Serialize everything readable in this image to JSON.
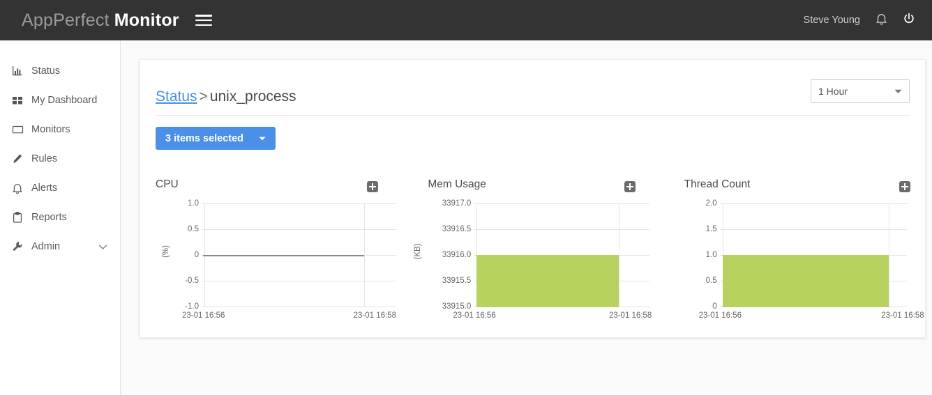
{
  "header": {
    "brand_primary": "AppPerfect",
    "brand_secondary": "Monitor",
    "menu_icon": "hamburger-icon",
    "username": "Steve Young",
    "bell_icon": "bell-icon",
    "power_icon": "power-icon"
  },
  "sidebar": {
    "items": [
      {
        "label": "Status",
        "icon": "bar-chart-icon",
        "has_caret": false
      },
      {
        "label": "My Dashboard",
        "icon": "grid-icon",
        "has_caret": false
      },
      {
        "label": "Monitors",
        "icon": "monitor-icon",
        "has_caret": false
      },
      {
        "label": "Rules",
        "icon": "pencil-icon",
        "has_caret": false
      },
      {
        "label": "Alerts",
        "icon": "bell-icon",
        "has_caret": false
      },
      {
        "label": "Reports",
        "icon": "clipboard-icon",
        "has_caret": false
      },
      {
        "label": "Admin",
        "icon": "wrench-icon",
        "has_caret": true
      }
    ]
  },
  "main": {
    "breadcrumb": {
      "link": "Status",
      "separator": ">",
      "current": "unix_process"
    },
    "time_range": {
      "selected": "1 Hour",
      "caret_icon": "chevron-down-icon"
    },
    "multiselect": {
      "label": "3 items selected",
      "caret_icon": "caret-down-icon",
      "accent_color": "#4a90e8"
    }
  },
  "colors": {
    "series_green": "#b7d25e",
    "link_blue": "#4a90e2",
    "header_dark": "#333333"
  },
  "chart_data": [
    {
      "type": "area",
      "title": "CPU",
      "expand_icon": "plus-icon",
      "ylabel": "(%)",
      "xlabel": "",
      "yticks": [
        "1.0",
        "0.5",
        "0",
        "-0.5",
        "-1.0"
      ],
      "ylim": [
        -1.0,
        1.0
      ],
      "xticks": [
        "23-01 16:56",
        "23-01 16:58"
      ],
      "x": [
        "23-01 16:56",
        "23-01 16:58"
      ],
      "values": [
        0,
        0
      ],
      "grid": true,
      "legend": false
    },
    {
      "type": "area",
      "title": "Mem Usage",
      "expand_icon": "plus-icon",
      "ylabel": "(KB)",
      "xlabel": "",
      "yticks": [
        "33917.0",
        "33916.5",
        "33916.0",
        "33915.5",
        "33915.0"
      ],
      "ylim": [
        33915.0,
        33917.0
      ],
      "xticks": [
        "23-01 16:56",
        "23-01 16:58"
      ],
      "x": [
        "23-01 16:56",
        "23-01 16:58"
      ],
      "values": [
        33916.0,
        33916.0
      ],
      "grid": true,
      "legend": false
    },
    {
      "type": "area",
      "title": "Thread Count",
      "expand_icon": "plus-icon",
      "ylabel": "",
      "xlabel": "",
      "yticks": [
        "2.0",
        "1.5",
        "1.0",
        "0.5",
        "0"
      ],
      "ylim": [
        0,
        2.0
      ],
      "xticks": [
        "23-01 16:56",
        "23-01 16:58"
      ],
      "x": [
        "23-01 16:56",
        "23-01 16:58"
      ],
      "values": [
        1.0,
        1.0
      ],
      "grid": true,
      "legend": false
    }
  ]
}
